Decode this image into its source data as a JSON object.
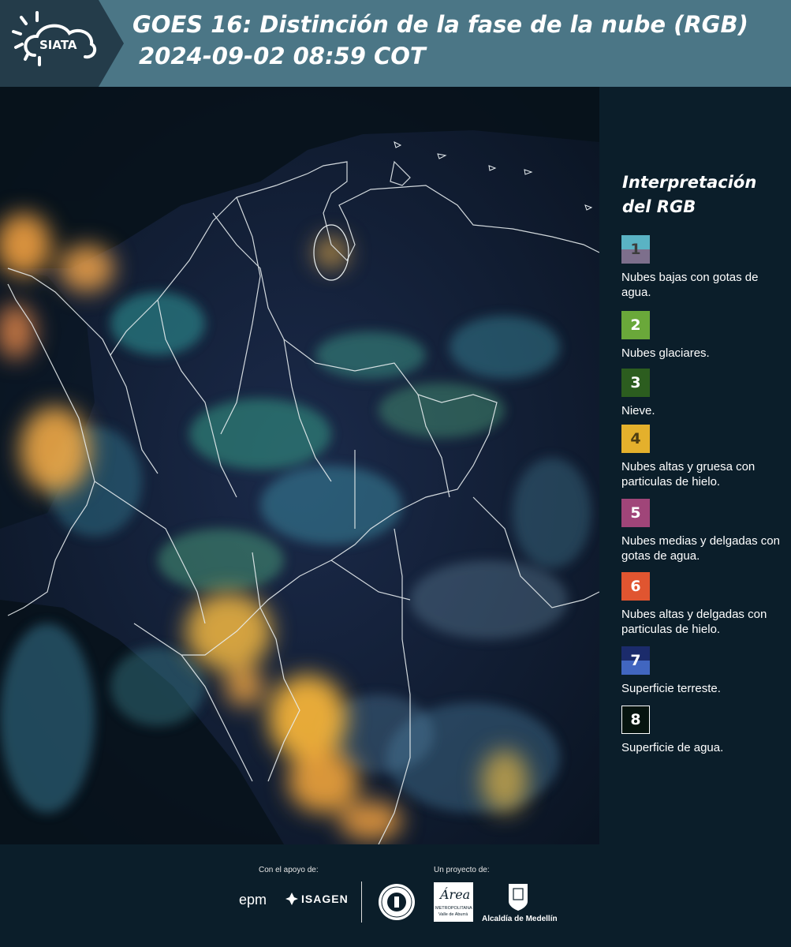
{
  "header": {
    "title_line1": "GOES 16: Distinción de la fase de la nube (RGB)",
    "title_line2": "2024-09-02 08:59 COT",
    "logo_text": "SIATA"
  },
  "legend": {
    "title_line1": "Interpretación",
    "title_line2": "del RGB",
    "items": [
      {
        "number": "1",
        "label": "Nubes bajas con gotas de agua.",
        "color_top": "#5ab3c4",
        "color_bottom": "#7d6f8c",
        "text_color": "#3d3d3d"
      },
      {
        "number": "2",
        "label": "Nubes glaciares.",
        "color_top": "#6aa83a",
        "color_bottom": "#6aa83a",
        "text_color": "#ffffff"
      },
      {
        "number": "3",
        "label": "Nieve.",
        "color_top": "#2c5d1f",
        "color_bottom": "#2c5d1f",
        "text_color": "#ffffff"
      },
      {
        "number": "4",
        "label": "Nubes altas y gruesa con particulas de hielo.",
        "color_top": "#e4b02c",
        "color_bottom": "#e4b02c",
        "text_color": "#4d3d12"
      },
      {
        "number": "5",
        "label": "Nubes medias y delgadas con gotas de agua.",
        "color_top": "#a04579",
        "color_bottom": "#a04579",
        "text_color": "#ffffff"
      },
      {
        "number": "6",
        "label": "Nubes altas y delgadas con particulas de hielo.",
        "color_top": "#e05530",
        "color_bottom": "#e05530",
        "text_color": "#ffffff"
      },
      {
        "number": "7",
        "label": "Superficie terreste.",
        "color_top": "#1b2b6b",
        "color_bottom": "#4166c0",
        "text_color": "#ffffff"
      },
      {
        "number": "8",
        "label": "Superficie de agua.",
        "color_top": "#06140f",
        "color_bottom": "#06140f",
        "text_color": "#ffffff"
      }
    ]
  },
  "footer": {
    "support_caption": "Con el apoyo de:",
    "project_caption": "Un proyecto de:",
    "logo_epm": "epm",
    "logo_isagen": "ISAGEN",
    "logo_area_main": "Área",
    "logo_area_sub1": "METROPOLITANA",
    "logo_area_sub2": "Valle de Aburrá",
    "logo_alcaldia": "Alcaldía de Medellín"
  },
  "colors": {
    "header_bg": "#4b7686",
    "logo_bg": "#243c4a",
    "page_bg": "#0b1e2a"
  }
}
